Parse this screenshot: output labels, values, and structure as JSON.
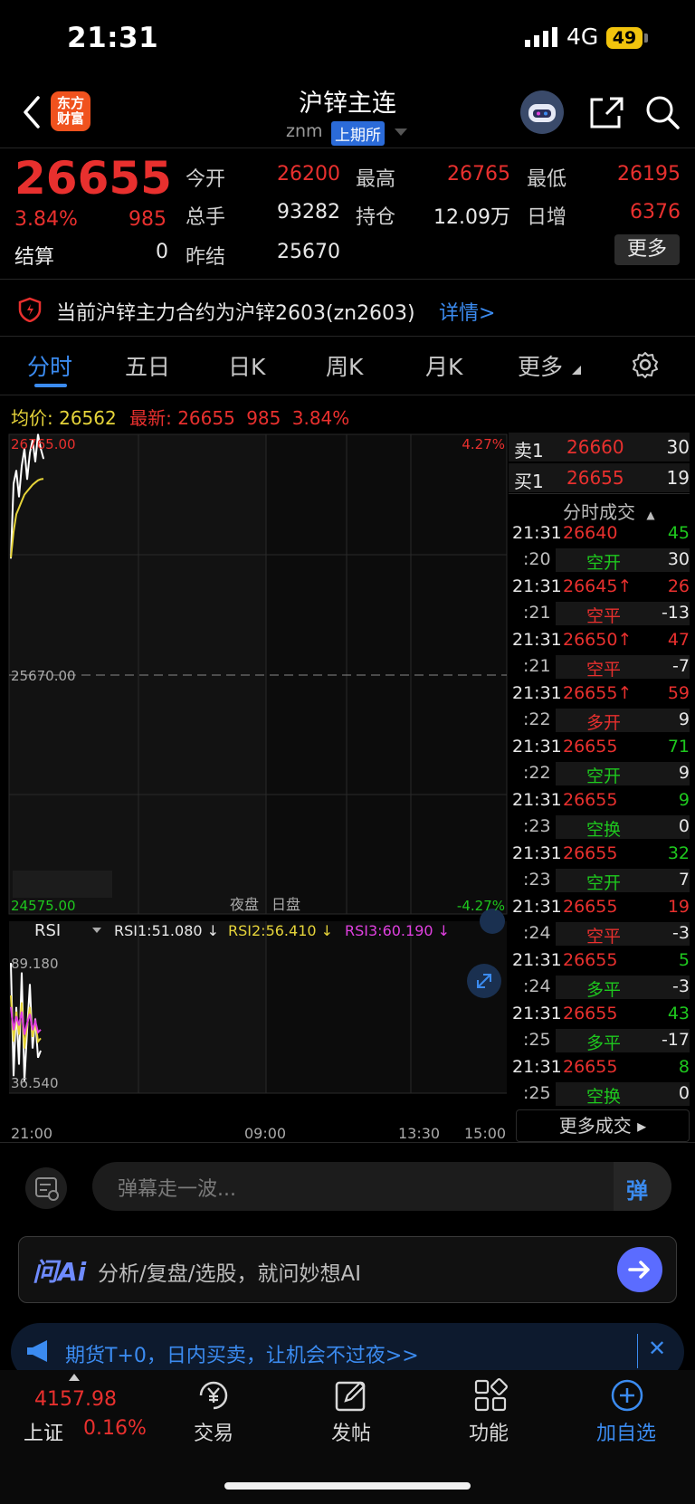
{
  "status_bar": {
    "time": "21:31",
    "network": "4G",
    "battery": "49"
  },
  "header": {
    "logo_line1": "东方",
    "logo_line2": "财富",
    "title": "沪锌主连",
    "code": "znm",
    "exchange": "上期所"
  },
  "quote": {
    "price": "26655",
    "change_pct": "3.84%",
    "change": "985",
    "settle_label": "结算",
    "settle_value": "0",
    "open_label": "今开",
    "open_value": "26200",
    "high_label": "最高",
    "high_value": "26765",
    "low_label": "最低",
    "low_value": "26195",
    "volume_label": "总手",
    "volume_value": "93282",
    "oi_label": "持仓",
    "oi_value": "12.09万",
    "oi_chg_label": "日增",
    "oi_chg_value": "6376",
    "prev_settle_label": "昨结",
    "prev_settle_value": "25670",
    "more_label": "更多"
  },
  "notice": {
    "text": "当前沪锌主力合约为沪锌2603(zn2603)",
    "link": "详情>"
  },
  "tabs": [
    "分时",
    "五日",
    "日K",
    "周K",
    "月K",
    "更多"
  ],
  "infoline": {
    "avg_label": "均价:",
    "avg_value": "26562",
    "latest_label": "最新:",
    "latest_value": "26655",
    "latest_change": "985",
    "latest_pct": "3.84%"
  },
  "chart_labels": {
    "y_top": "26765.00",
    "y_mid": "25670.00",
    "y_bottom": "24575.00",
    "pct_top": "4.27%",
    "pct_bottom": "-4.27%",
    "night": "夜盘",
    "day": "日盘",
    "rsi_selector": "RSI",
    "rsi1": "RSI1:51.080 ↓",
    "rsi2": "RSI2:56.410 ↓",
    "rsi3": "RSI3:60.190 ↓",
    "rsi_top": "89.180",
    "rsi_bottom": "36.540",
    "x_ticks": [
      "21:00",
      "09:00",
      "13:30",
      "15:00"
    ]
  },
  "chart_data": {
    "type": "line",
    "title": "",
    "ylim": [
      24575,
      26765
    ],
    "ref_line": 25670,
    "series": [
      {
        "values": [
          26200,
          26540,
          26600,
          26480,
          26620,
          26700,
          26560,
          26680,
          26740,
          26640,
          26765,
          26700,
          26655
        ]
      },
      {
        "values": [
          26200,
          26320,
          26400,
          26430,
          26460,
          26490,
          26505,
          26520,
          26535,
          26545,
          26555,
          26560,
          26562
        ]
      }
    ],
    "rsi": {
      "ylim": [
        36.54,
        89.18
      ],
      "rsi1": [
        89.18,
        40,
        70,
        45,
        85,
        38,
        60,
        80,
        52,
        65,
        48,
        51.08
      ],
      "rsi2": [
        75,
        55,
        68,
        58,
        72,
        52,
        62,
        70,
        57,
        64,
        55,
        56.41
      ],
      "rsi3": [
        70,
        60,
        66,
        62,
        68,
        58,
        63,
        67,
        60,
        64,
        59,
        60.19
      ]
    }
  },
  "order_book": {
    "sell_label": "卖1",
    "sell_price": "26660",
    "sell_vol": "30",
    "buy_label": "买1",
    "buy_price": "26655",
    "buy_vol": "19"
  },
  "ticks_header": "分时成交",
  "ticks": [
    {
      "time": "21:31",
      "price": "26640",
      "vol": "45",
      "sub": ":20",
      "type": "空开",
      "qty": "30"
    },
    {
      "time": "21:31",
      "price": "26645↑",
      "vol": "26",
      "sub": ":21",
      "type": "空平",
      "qty": "-13"
    },
    {
      "time": "21:31",
      "price": "26650↑",
      "vol": "47",
      "sub": ":21",
      "type": "空平",
      "qty": "-7"
    },
    {
      "time": "21:31",
      "price": "26655↑",
      "vol": "59",
      "sub": ":22",
      "type": "多开",
      "qty": "9"
    },
    {
      "time": "21:31",
      "price": "26655",
      "vol": "71",
      "sub": ":22",
      "type": "空开",
      "qty": "9"
    },
    {
      "time": "21:31",
      "price": "26655",
      "vol": "9",
      "sub": ":23",
      "type": "空换",
      "qty": "0"
    },
    {
      "time": "21:31",
      "price": "26655",
      "vol": "32",
      "sub": ":23",
      "type": "空开",
      "qty": "7"
    },
    {
      "time": "21:31",
      "price": "26655",
      "vol": "19",
      "sub": ":24",
      "type": "空平",
      "qty": "-3"
    },
    {
      "time": "21:31",
      "price": "26655",
      "vol": "5",
      "sub": ":24",
      "type": "多平",
      "qty": "-3"
    },
    {
      "time": "21:31",
      "price": "26655",
      "vol": "43",
      "sub": ":25",
      "type": "多平",
      "qty": "-17"
    },
    {
      "time": "21:31",
      "price": "26655",
      "vol": "8",
      "sub": ":25",
      "type": "空换",
      "qty": "0"
    }
  ],
  "tick_colors": {
    "vol": [
      "green",
      "red",
      "red",
      "red",
      "green",
      "green",
      "green",
      "red",
      "green",
      "green",
      "green"
    ],
    "type": [
      "green",
      "red",
      "red",
      "red",
      "green",
      "green",
      "green",
      "red",
      "green",
      "green",
      "green"
    ]
  },
  "more_trades": "更多成交 ▸",
  "comment": {
    "placeholder": "弹幕走一波...",
    "danmu": "弹"
  },
  "ai": {
    "logo": "问Ai",
    "text": "分析/复盘/选股，就问妙想AI"
  },
  "promo": {
    "text": "期货T+0，日内买卖，让机会不过夜>>",
    "close": "✕"
  },
  "bottom_nav": {
    "index_value": "4157.98",
    "index_name": "上证",
    "index_pct": "0.16%",
    "items": [
      "交易",
      "发帖",
      "功能",
      "加自选"
    ]
  },
  "colors": {
    "up": "#e8302e",
    "down": "#1ec81e",
    "accent": "#3b8bf0",
    "avg_line": "#e6d43a"
  }
}
